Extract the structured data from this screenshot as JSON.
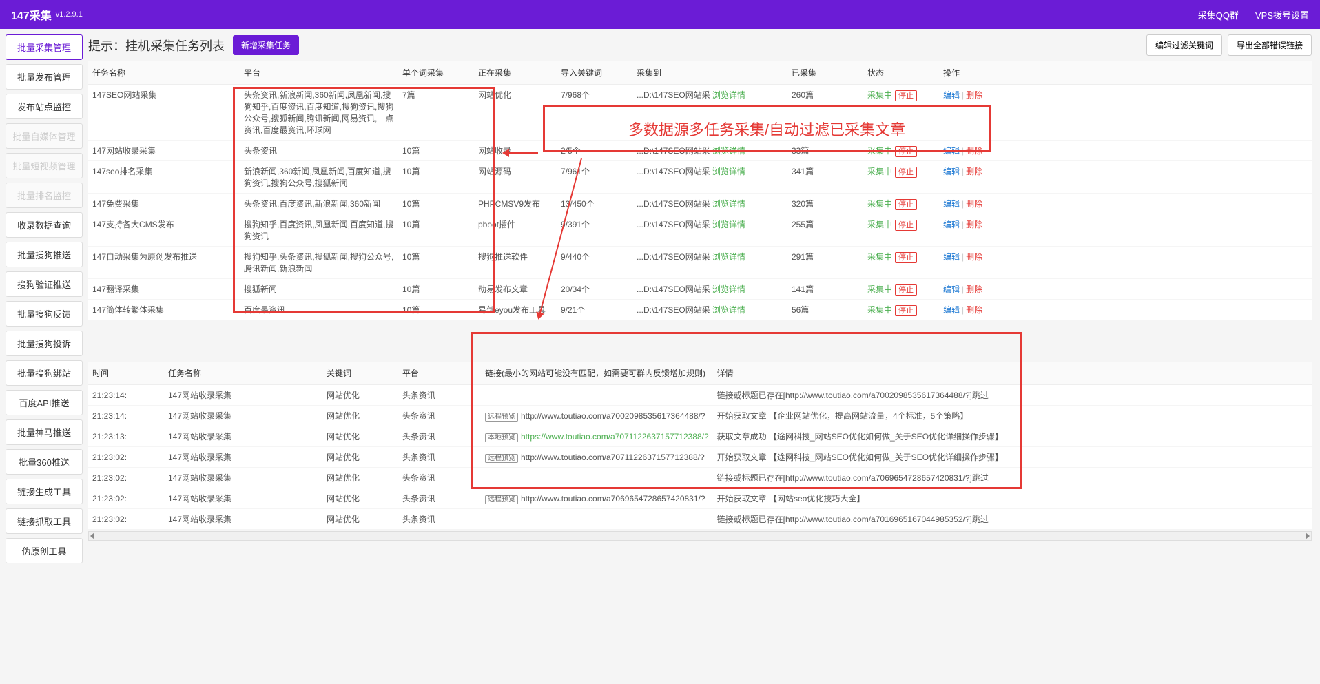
{
  "header": {
    "title": "147采集",
    "version": "v1.2.9.1",
    "link_qq": "采集QQ群",
    "link_vps": "VPS拨号设置"
  },
  "sidebar": {
    "items": [
      {
        "label": "批量采集管理",
        "state": "active"
      },
      {
        "label": "批量发布管理",
        "state": ""
      },
      {
        "label": "发布站点监控",
        "state": ""
      },
      {
        "label": "批量自媒体管理",
        "state": "disabled"
      },
      {
        "label": "批量短视频管理",
        "state": "disabled"
      },
      {
        "label": "批量排名监控",
        "state": "disabled"
      },
      {
        "label": "收录数据查询",
        "state": ""
      },
      {
        "label": "批量搜狗推送",
        "state": ""
      },
      {
        "label": "搜狗验证推送",
        "state": ""
      },
      {
        "label": "批量搜狗反馈",
        "state": ""
      },
      {
        "label": "批量搜狗投诉",
        "state": ""
      },
      {
        "label": "批量搜狗绑站",
        "state": ""
      },
      {
        "label": "百度API推送",
        "state": ""
      },
      {
        "label": "批量神马推送",
        "state": ""
      },
      {
        "label": "批量360推送",
        "state": ""
      },
      {
        "label": "链接生成工具",
        "state": ""
      },
      {
        "label": "链接抓取工具",
        "state": ""
      },
      {
        "label": "伪原创工具",
        "state": ""
      }
    ]
  },
  "panel": {
    "title": "提示：挂机采集任务列表",
    "btn_new": "新增采集任务",
    "btn_filter": "编辑过滤关键词",
    "btn_export": "导出全部错误链接"
  },
  "overlay_text": "多数据源多任务采集/自动过滤已采集文章",
  "task_table": {
    "headers": [
      "任务名称",
      "平台",
      "单个词采集",
      "正在采集",
      "导入关键词",
      "采集到",
      "已采集",
      "状态",
      "操作"
    ],
    "browse_label": "浏览详情",
    "status_label": "采集中",
    "stop_label": "停止",
    "edit_label": "编辑",
    "delete_label": "删除",
    "rows": [
      {
        "name": "147SEO网站采集",
        "platform": "头条资讯,新浪新闻,360新闻,凤凰新闻,搜狗知乎,百度资讯,百度知道,搜狗资讯,搜狗公众号,搜狐新闻,腾讯新闻,网易资讯,一点资讯,百度最资讯,环球网",
        "count": "7篇",
        "collecting": "网站优化",
        "keywords": "7/968个",
        "dest": "...D:\\147SEO网站采",
        "collected": "260篇"
      },
      {
        "name": "147网站收录采集",
        "platform": "头条资讯",
        "count": "10篇",
        "collecting": "网站收录",
        "keywords": "2/5个",
        "dest": "...D:\\147SEO网站采",
        "collected": "33篇"
      },
      {
        "name": "147seo排名采集",
        "platform": "新浪新闻,360新闻,凤凰新闻,百度知道,搜狗资讯,搜狗公众号,搜狐新闻",
        "count": "10篇",
        "collecting": "网站源码",
        "keywords": "7/961个",
        "dest": "...D:\\147SEO网站采",
        "collected": "341篇"
      },
      {
        "name": "147免费采集",
        "platform": "头条资讯,百度资讯,新浪新闻,360新闻",
        "count": "10篇",
        "collecting": "PHPCMSV9发布",
        "keywords": "13/450个",
        "dest": "...D:\\147SEO网站采",
        "collected": "320篇"
      },
      {
        "name": "147支持各大CMS发布",
        "platform": "搜狗知乎,百度资讯,凤凰新闻,百度知道,搜狗资讯",
        "count": "10篇",
        "collecting": "pboot插件",
        "keywords": "9/391个",
        "dest": "...D:\\147SEO网站采",
        "collected": "255篇"
      },
      {
        "name": "147自动采集为原创发布推送",
        "platform": "搜狗知乎,头条资讯,搜狐新闻,搜狗公众号,腾讯新闻,新浪新闻",
        "count": "10篇",
        "collecting": "搜狗推送软件",
        "keywords": "9/440个",
        "dest": "...D:\\147SEO网站采",
        "collected": "291篇"
      },
      {
        "name": "147翻译采集",
        "platform": "搜狐新闻",
        "count": "10篇",
        "collecting": "动易发布文章",
        "keywords": "20/34个",
        "dest": "...D:\\147SEO网站采",
        "collected": "141篇"
      },
      {
        "name": "147简体转繁体采集",
        "platform": "百度最资讯",
        "count": "10篇",
        "collecting": "易优eyou发布工具",
        "keywords": "9/21个",
        "dest": "...D:\\147SEO网站采",
        "collected": "56篇"
      }
    ]
  },
  "log_table": {
    "headers": [
      "时间",
      "任务名称",
      "关键词",
      "平台",
      "链接(最小的网站可能没有匹配，如需要可群内反馈增加规则)",
      "详情"
    ],
    "badge_remote": "远程预览",
    "badge_local": "本地预览",
    "rows": [
      {
        "time": "21:23:14:",
        "task": "147网站收录采集",
        "keyword": "网站优化",
        "platform": "头条资讯",
        "link": "",
        "detail": "链接或标题已存在[http://www.toutiao.com/a7002098535617364488/?]跳过"
      },
      {
        "time": "21:23:14:",
        "task": "147网站收录采集",
        "keyword": "网站优化",
        "platform": "头条资讯",
        "link_badge": "remote",
        "link": "http://www.toutiao.com/a7002098535617364488/?",
        "detail": "开始获取文章 【企业网站优化，提高网站流量，4个标准，5个策略】"
      },
      {
        "time": "21:23:13:",
        "task": "147网站收录采集",
        "keyword": "网站优化",
        "platform": "头条资讯",
        "link_badge": "local",
        "link": "https://www.toutiao.com/a7071122637157712388/?",
        "link_green": true,
        "detail": "获取文章成功 【途网科技_网站SEO优化如何做_关于SEO优化详细操作步骤】"
      },
      {
        "time": "21:23:02:",
        "task": "147网站收录采集",
        "keyword": "网站优化",
        "platform": "头条资讯",
        "link_badge": "remote",
        "link": "http://www.toutiao.com/a7071122637157712388/?",
        "detail": "开始获取文章 【途网科技_网站SEO优化如何做_关于SEO优化详细操作步骤】"
      },
      {
        "time": "21:23:02:",
        "task": "147网站收录采集",
        "keyword": "网站优化",
        "platform": "头条资讯",
        "link": "",
        "detail": "链接或标题已存在[http://www.toutiao.com/a7069654728657420831/?]跳过"
      },
      {
        "time": "21:23:02:",
        "task": "147网站收录采集",
        "keyword": "网站优化",
        "platform": "头条资讯",
        "link_badge": "remote",
        "link": "http://www.toutiao.com/a7069654728657420831/?",
        "detail": "开始获取文章 【网站seo优化技巧大全】"
      },
      {
        "time": "21:23:02:",
        "task": "147网站收录采集",
        "keyword": "网站优化",
        "platform": "头条资讯",
        "link": "",
        "detail": "链接或标题已存在[http://www.toutiao.com/a7016965167044985352/?]跳过"
      }
    ]
  }
}
